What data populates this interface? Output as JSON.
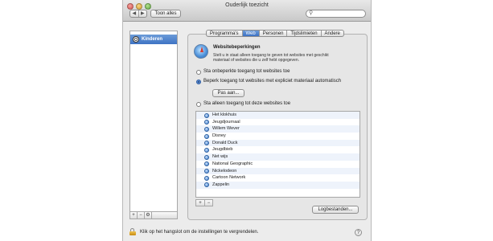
{
  "window": {
    "title": "Ouderlijk toezicht"
  },
  "toolbar": {
    "back_glyph": "◀",
    "forward_glyph": "▶",
    "show_all_label": "Toon alles",
    "search_placeholder": "",
    "search_icon": "magnifier-icon"
  },
  "sidebar": {
    "items": [
      {
        "label": "Kinderen",
        "icon": "soccer-ball-icon",
        "selected": true
      }
    ],
    "controls": {
      "add": "+",
      "remove": "−",
      "action": "⚙"
    }
  },
  "tabs": [
    {
      "label": "Programma's",
      "active": false
    },
    {
      "label": "Web",
      "active": true
    },
    {
      "label": "Personen",
      "active": false
    },
    {
      "label": "Tijdslimieten",
      "active": false
    },
    {
      "label": "Andere",
      "active": false
    }
  ],
  "web": {
    "heading": "Websitebeperkingen",
    "description": "Stelt u in staat alleen toegang te geven tot websites met geschikt materiaal of websites die u zelf hebt opgegeven.",
    "options": [
      {
        "label": "Sta onbeperkte toegang tot websites toe",
        "checked": false
      },
      {
        "label": "Beperk toegang tot websites met expliciet materiaal automatisch",
        "checked": true
      },
      {
        "label": "Sta alleen toegang tot deze websites toe",
        "checked": false
      }
    ],
    "adjust_button": "Pas aan...",
    "sites": [
      "Het klokhuis",
      "Jeugdjournaal",
      "Willem Wever",
      "Disney",
      "Donald Duck",
      "Jeugdbieb",
      "Net wijs",
      "National Geographic",
      "Nickelodeon",
      "Cartoon Network",
      "Zappelin"
    ],
    "list_controls": {
      "add": "+",
      "remove": "−"
    },
    "logs_button": "Logbestanden..."
  },
  "footer": {
    "lock_text": "Klik op het hangslot om de instellingen te vergrendelen.",
    "help_label": "?"
  }
}
